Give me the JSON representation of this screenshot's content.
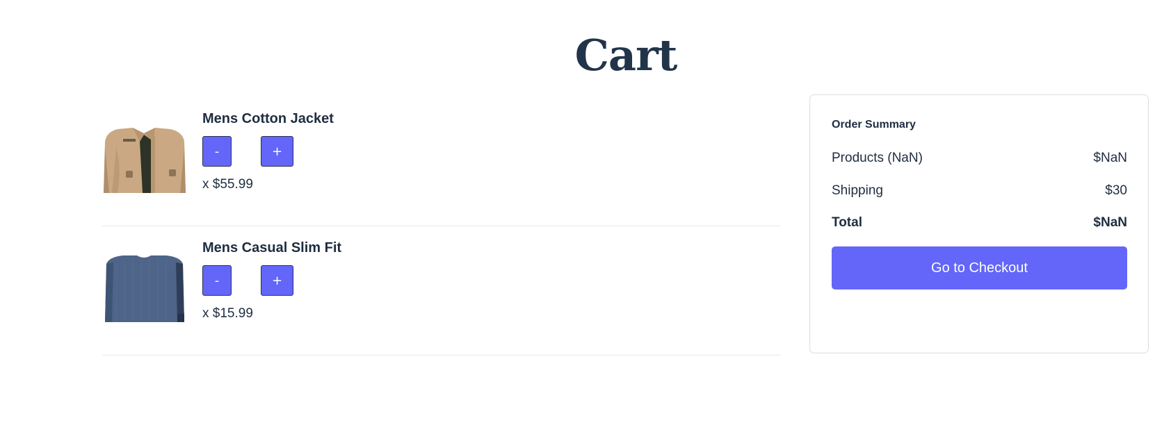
{
  "page": {
    "title": "Cart"
  },
  "cart": {
    "items": [
      {
        "name": "Mens Cotton Jacket",
        "minus_label": "-",
        "plus_label": "+",
        "price_text": "x $55.99",
        "image_icon": "jacket-image"
      },
      {
        "name": "Mens Casual Slim Fit",
        "minus_label": "-",
        "plus_label": "+",
        "price_text": "x $15.99",
        "image_icon": "shirt-image"
      }
    ]
  },
  "summary": {
    "heading": "Order Summary",
    "products_label": "Products (NaN)",
    "products_value": "$NaN",
    "shipping_label": "Shipping",
    "shipping_value": "$30",
    "total_label": "Total",
    "total_value": "$NaN",
    "checkout_label": "Go to Checkout"
  },
  "colors": {
    "accent": "#6366f8",
    "text": "#1e2d40",
    "title": "#22344a",
    "divider": "#e8e8ea",
    "card_border": "#dcdde2"
  }
}
